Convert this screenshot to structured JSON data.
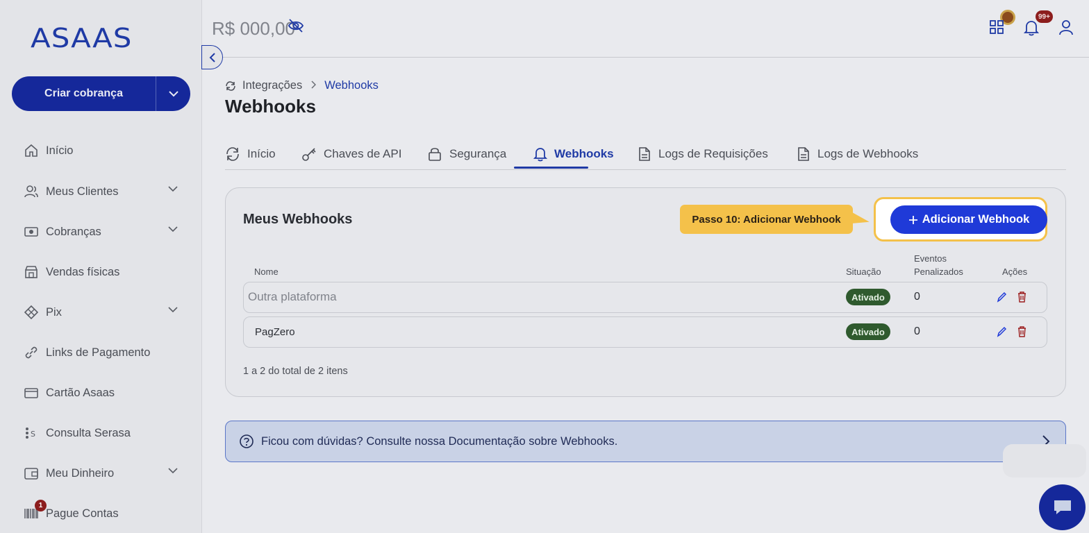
{
  "sidebar": {
    "logo": "ASAAS",
    "create_button": "Criar cobrança",
    "items": [
      {
        "label": "Início"
      },
      {
        "label": "Meus Clientes"
      },
      {
        "label": "Cobranças"
      },
      {
        "label": "Vendas físicas"
      },
      {
        "label": "Pix"
      },
      {
        "label": "Links de Pagamento"
      },
      {
        "label": "Cartão Asaas"
      },
      {
        "label": "Consulta Serasa"
      },
      {
        "label": "Meu Dinheiro"
      },
      {
        "label": "Pague Contas"
      }
    ],
    "pague_contas_badge": "1"
  },
  "topbar": {
    "balance": "R$ 000,00",
    "notifications_badge": "99+"
  },
  "breadcrumb": {
    "parent": "Integrações",
    "current": "Webhooks"
  },
  "page_title": "Webhooks",
  "tabs": [
    {
      "label": "Início"
    },
    {
      "label": "Chaves de API"
    },
    {
      "label": "Segurança"
    },
    {
      "label": "Webhooks"
    },
    {
      "label": "Logs de Requisições"
    },
    {
      "label": "Logs de Webhooks"
    }
  ],
  "card": {
    "title": "Meus Webhooks",
    "add_button": "Adicionar Webhook",
    "tooltip": "Passo 10: Adicionar Webhook",
    "columns": {
      "name": "Nome",
      "status": "Situação",
      "penalized_line1": "Eventos",
      "penalized_line2": "Penalizados",
      "actions": "Ações"
    },
    "rows": [
      {
        "name": "Outra plataforma",
        "status": "Ativado",
        "penalized": "0"
      },
      {
        "name": "PagZero",
        "status": "Ativado",
        "penalized": "0"
      }
    ],
    "pagination_info": "1 a 2 do total de 2 itens"
  },
  "help": {
    "text": "Ficou com dúvidas? Consulte nossa Documentação sobre Webhooks."
  },
  "colors": {
    "brand": "#1f3aa5",
    "button_primary": "#1f3ad8",
    "tooltip": "#f4c14a",
    "status_active": "#2f5a2e",
    "badge": "#8c1d1d"
  }
}
